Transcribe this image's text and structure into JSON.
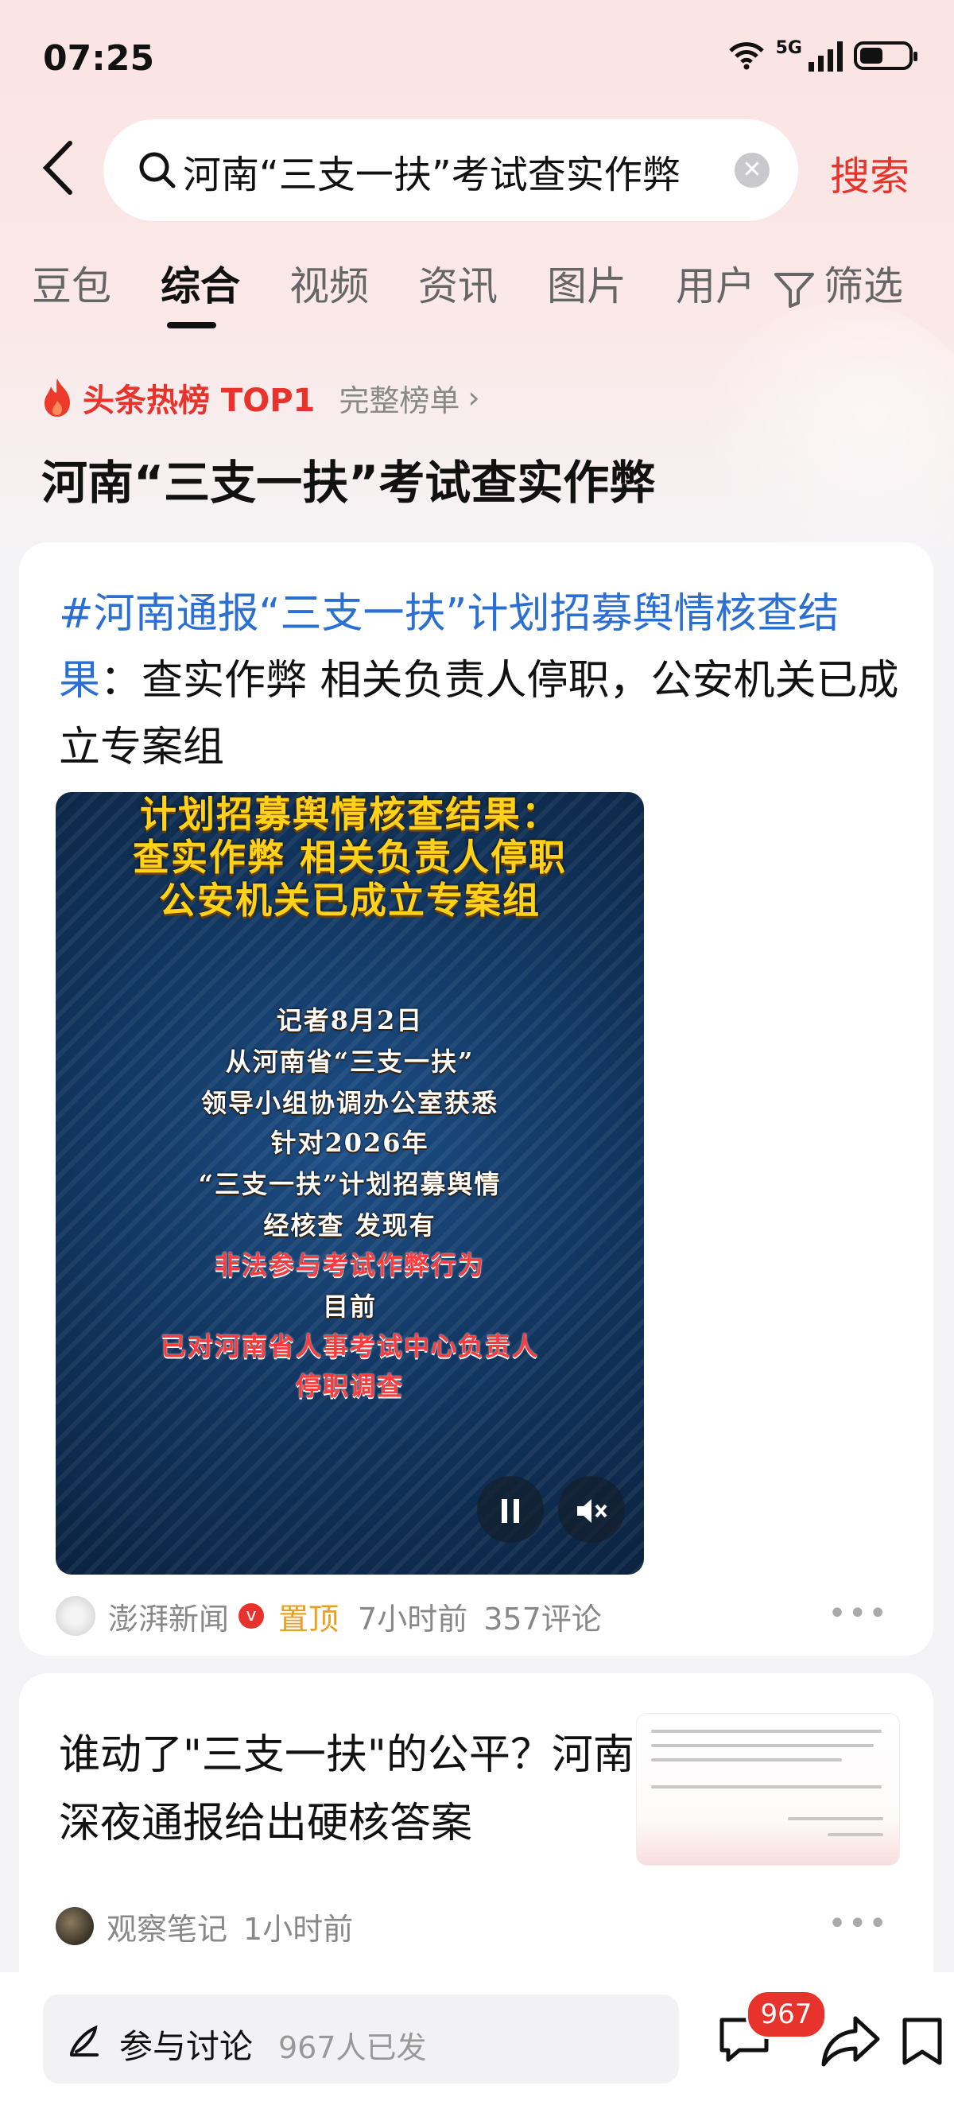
{
  "status_bar": {
    "time": "07:25",
    "network": "5G"
  },
  "search": {
    "query": "河南“三支一扶”考试查实作弊",
    "button": "搜索"
  },
  "tabs": [
    {
      "label": "豆包"
    },
    {
      "label": "综合"
    },
    {
      "label": "视频"
    },
    {
      "label": "资讯"
    },
    {
      "label": "图片"
    },
    {
      "label": "用户"
    }
  ],
  "filter_label": "筛选",
  "hot": {
    "label": "头条热榜 TOP1",
    "full_list": "完整榜单"
  },
  "topic_title": "河南“三支一扶”考试查实作弊",
  "card1": {
    "hashtag": "#河南通报“三支一扶”计划招募舆情核查结果",
    "title_rest": "：查实作弊 相关负责人停职，公安机关已成立专案组",
    "video_lines": [
      "计划招募舆情核查结果：",
      "查实作弊  相关负责人停职",
      "公安机关已成立专案组",
      "记者8月2日",
      "从河南省“三支一扶”",
      "领导小组协调办公室获悉",
      "针对2026年",
      "“三支一扶”计划招募舆情",
      "经核查 发现有",
      "非法参与考试作弊行为",
      "目前",
      "已对河南省人事考试中心负责人",
      "停职调查"
    ],
    "source": "澎湃新闻",
    "pinned": "置顶",
    "time": "7小时前",
    "comments": "357评论"
  },
  "card2": {
    "title": "谁动了\"三支一扶\"的公平？河南深夜通报给出硬核答案",
    "source": "观察笔记",
    "time": "1小时前"
  },
  "bottom_bar": {
    "discuss_label": "参与讨论",
    "discuss_count": "967人已发",
    "comment_badge": "967"
  },
  "colors": {
    "accent_red": "#e8322c",
    "link_blue": "#2a6fd1",
    "pin_orange": "#e9a020"
  }
}
